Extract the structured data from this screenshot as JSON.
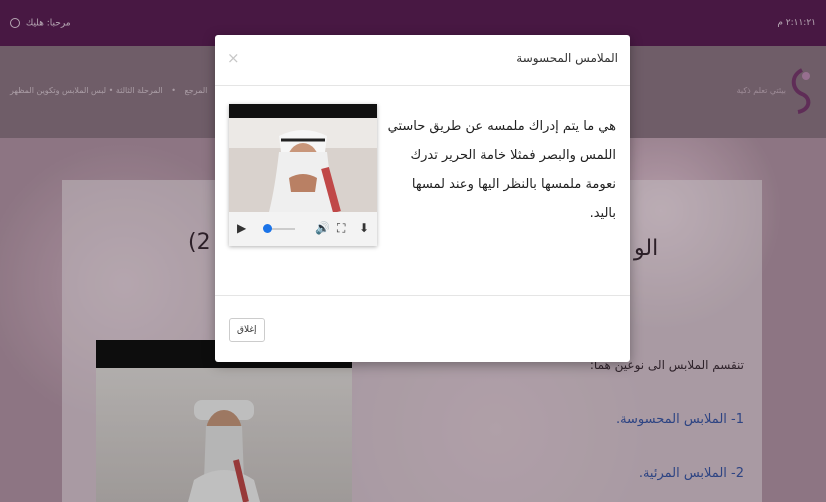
{
  "topbar": {
    "user_label": "مرحبا: هليك",
    "time": "٢:١١:٢١ م"
  },
  "nav": {
    "breadcrumb": [
      "المرجع",
      "المرحلة الثالثة • لبس الملابس وتكوين المظهر",
      "•"
    ],
    "logo_text": "بيئتي تعلم ذكية"
  },
  "page": {
    "heading_left": "(2",
    "heading_right": "الو",
    "intro": "تنقسم الملابس الى نوعين هما:",
    "list": [
      "1- الملابس المحسوسة.",
      "2- الملابس المرئية."
    ]
  },
  "modal": {
    "title": "الملامس المحسوسة",
    "close_symbol": "×",
    "body_lines": [
      "هي ما يتم إدراك ملمسه عن طريق حاستي",
      "اللمس والبصر فمثلا خامة الحرير تدرك",
      "نعومة ملمسها بالنظر اليها وعند لمسها باليد."
    ],
    "close_button": "إغلاق"
  },
  "video_controls": {
    "play": "▶",
    "volume": "🔊",
    "fullscreen": "⛶",
    "download": "⬇",
    "progress": 0.05
  },
  "colors": {
    "topbar": "#5d1f57",
    "accent": "#1a73e8",
    "link": "#3b58a8"
  }
}
